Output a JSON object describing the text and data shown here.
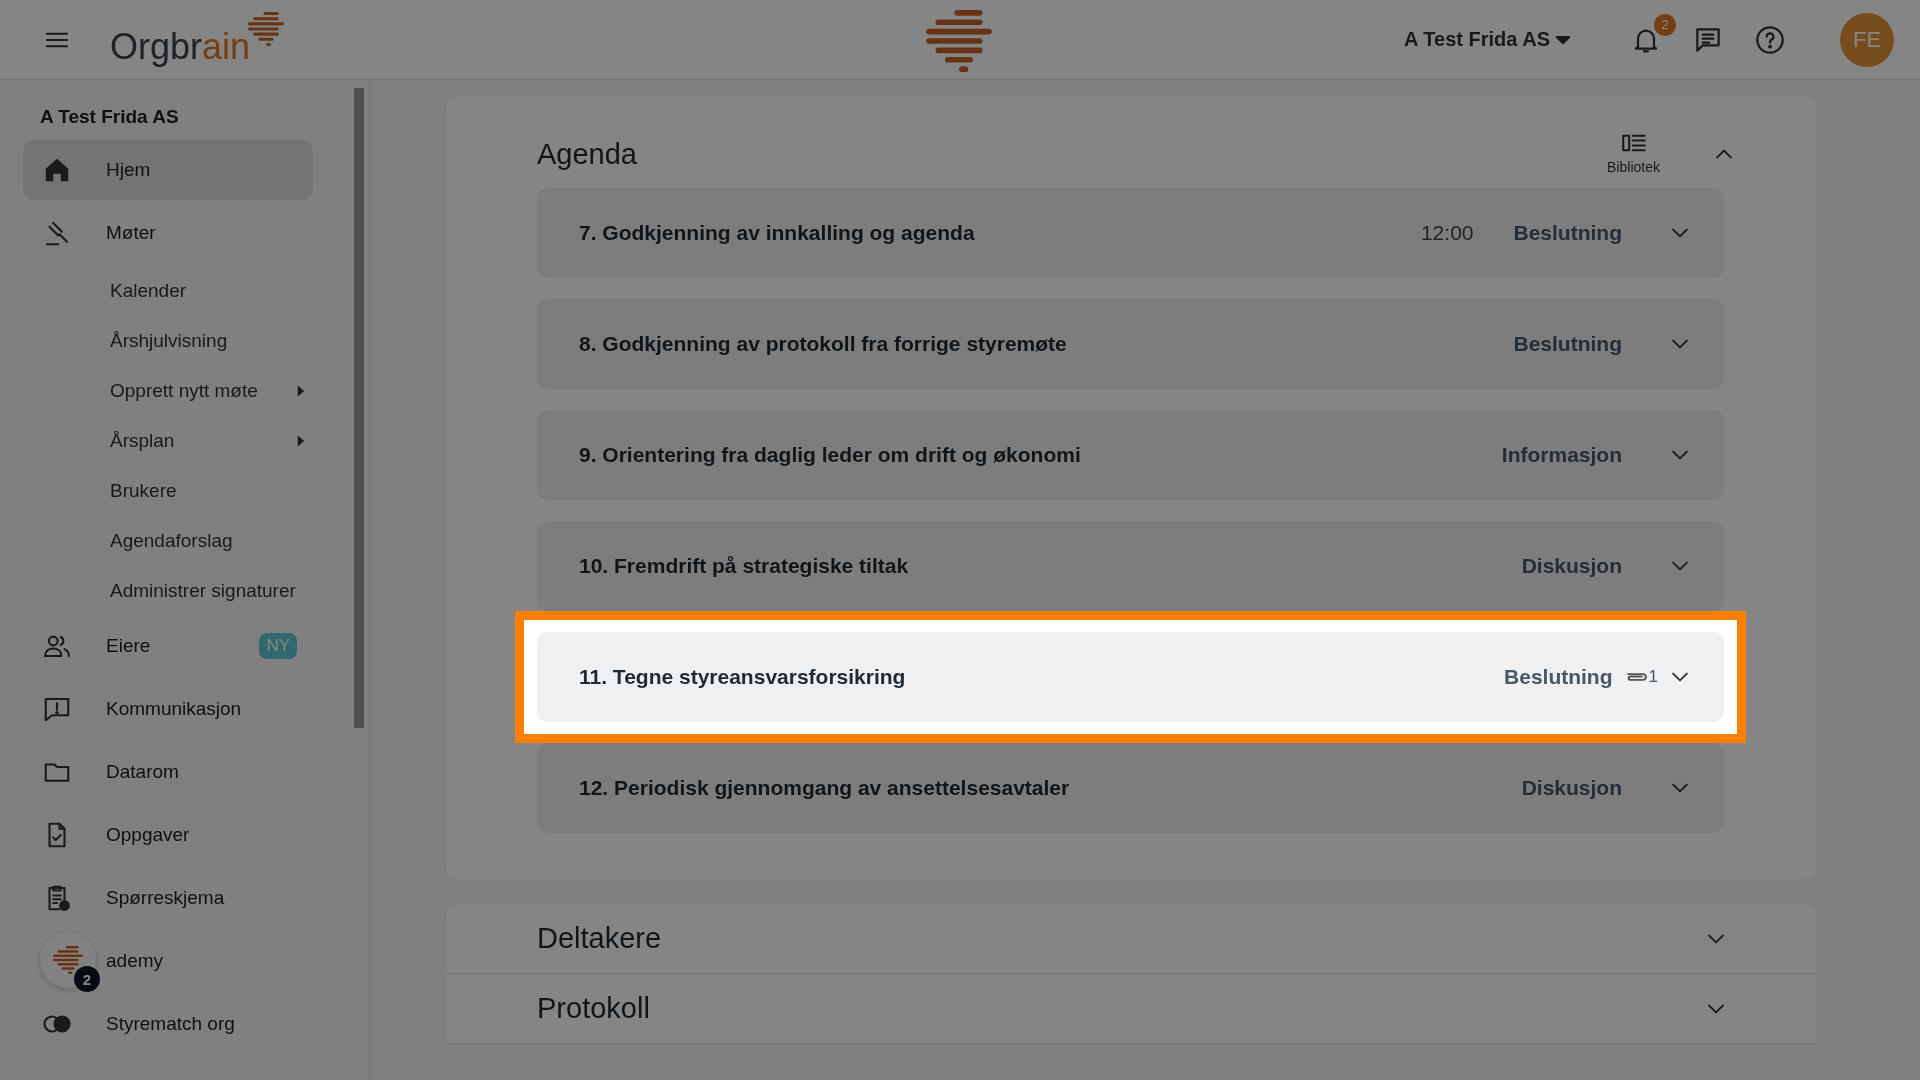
{
  "topbar": {
    "logo": [
      {
        "text": "Orgbr",
        "accent": false
      },
      {
        "text": "ain",
        "accent": true
      }
    ],
    "org_selector": "A Test Frida AS",
    "notifications": "2",
    "avatar": "FE"
  },
  "sidebar": {
    "org_title": "A Test Frida AS",
    "items": [
      {
        "label": "Hjem",
        "selected": true
      },
      {
        "label": "Møter",
        "selected": false,
        "children": [
          {
            "label": "Kalender",
            "submenu": false
          },
          {
            "label": "Årshjulvisning",
            "submenu": false
          },
          {
            "label": "Opprett nytt møte",
            "submenu": true
          },
          {
            "label": "Årsplan",
            "submenu": true
          },
          {
            "label": "Brukere",
            "submenu": false
          },
          {
            "label": "Agendaforslag",
            "submenu": false
          },
          {
            "label": "Administrer signaturer",
            "submenu": false
          }
        ]
      },
      {
        "label": "Eiere",
        "selected": false,
        "badge": "NY"
      },
      {
        "label": "Kommunikasjon",
        "selected": false
      },
      {
        "label": "Datarom",
        "selected": false
      },
      {
        "label": "Oppgaver",
        "selected": false
      },
      {
        "label": "Spørreskjema",
        "selected": false
      },
      {
        "label": "ademy",
        "selected": false
      },
      {
        "label": "Styrematch org",
        "selected": false
      }
    ]
  },
  "assistant": {
    "count": "2"
  },
  "agenda": {
    "title": "Agenda",
    "library": "Bibliotek",
    "expanded": true,
    "items": [
      {
        "title": "7. Godkjenning av innkalling og agenda",
        "time": "12:00",
        "type": "Beslutning",
        "highlighted": false
      },
      {
        "title": "8. Godkjenning av protokoll fra forrige styremøte",
        "type": "Beslutning",
        "highlighted": false
      },
      {
        "title": "9. Orientering fra daglig leder om drift og økonomi",
        "type": "Informasjon",
        "highlighted": false
      },
      {
        "title": "10. Fremdrift på strategiske tiltak",
        "type": "Diskusjon",
        "highlighted": false
      },
      {
        "title": "11. Tegne styreansvarsforsikring",
        "type": "Beslutning",
        "attachments": "1",
        "highlighted": true
      },
      {
        "title": "12. Periodisk gjennomgang av ansettelsesavtaler",
        "type": "Diskusjon",
        "highlighted": false
      }
    ]
  },
  "sections": [
    {
      "title": "Deltakere",
      "expanded": false
    },
    {
      "title": "Protokoll",
      "expanded": false
    }
  ]
}
